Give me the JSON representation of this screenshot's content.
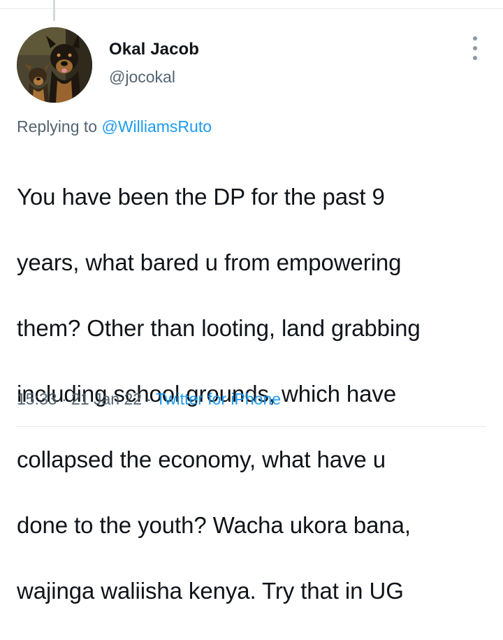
{
  "tweet": {
    "author": {
      "display_name": "Okal Jacob",
      "handle": "@jocokal",
      "avatar": "two-dogs-photo"
    },
    "replying_to": {
      "prefix": "Replying to ",
      "mention": "@WilliamsRuto"
    },
    "text_lines": [
      "You have been the DP for the past 9",
      "years, what bared u from empowering",
      "them? Other than looting, land grabbing",
      "including school grounds, which have",
      "collapsed the economy, what have u",
      "done to the youth? Wacha ukora bana,",
      "wajinga waliisha kenya. Try that in UG"
    ],
    "time": "15:33",
    "date": "21 Jan 22",
    "separator": " · ",
    "source": "Twitter for iPhone",
    "more_icon": "more-vertical-icon"
  },
  "colors": {
    "text": "#0f1419",
    "secondary": "#536471",
    "link": "#1d9bf0",
    "border": "#e6e9eb"
  }
}
